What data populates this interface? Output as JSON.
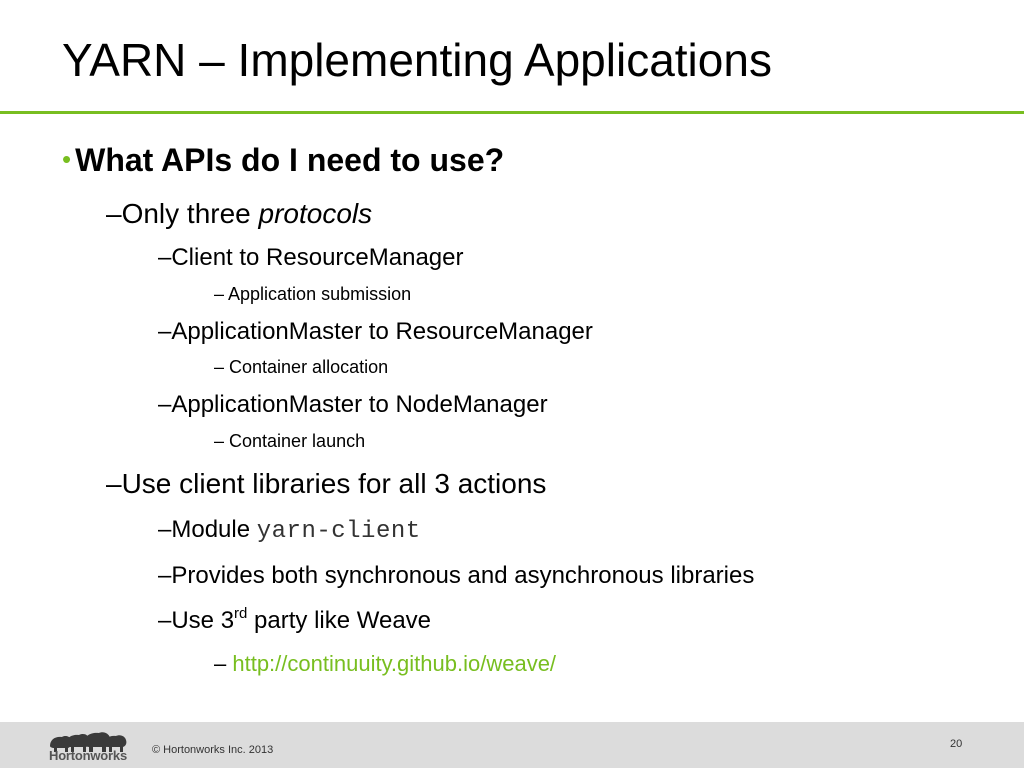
{
  "slide": {
    "title": "YARN – Implementing Applications",
    "bullet": "•",
    "question": "What APIs do I need to use?",
    "only_three_prefix": "–Only three ",
    "only_three_italic": "protocols",
    "proto1": "–Client to ResourceManager",
    "proto1_sub": "– Application submission",
    "proto2": "–ApplicationMaster to ResourceManager",
    "proto2_sub": "– Container allocation",
    "proto3": "–ApplicationMaster to NodeManager",
    "proto3_sub": "– Container launch",
    "client_libs": "–Use client libraries for all 3 actions",
    "module_prefix": "–Module ",
    "module_code": "yarn-client",
    "provides": "–Provides both synchronous and asynchronous libraries",
    "third_party_prefix": "–Use 3",
    "third_party_sup": "rd",
    "third_party_suffix": " party like Weave",
    "link_dash": "– ",
    "link_url": "http://continuuity.github.io/weave/"
  },
  "footer": {
    "logo_text": "Hortonworks",
    "copyright": "© Hortonworks Inc. 2013",
    "page_number": "20"
  },
  "colors": {
    "accent": "#78be20",
    "footer_bg": "#dcdcdc"
  }
}
